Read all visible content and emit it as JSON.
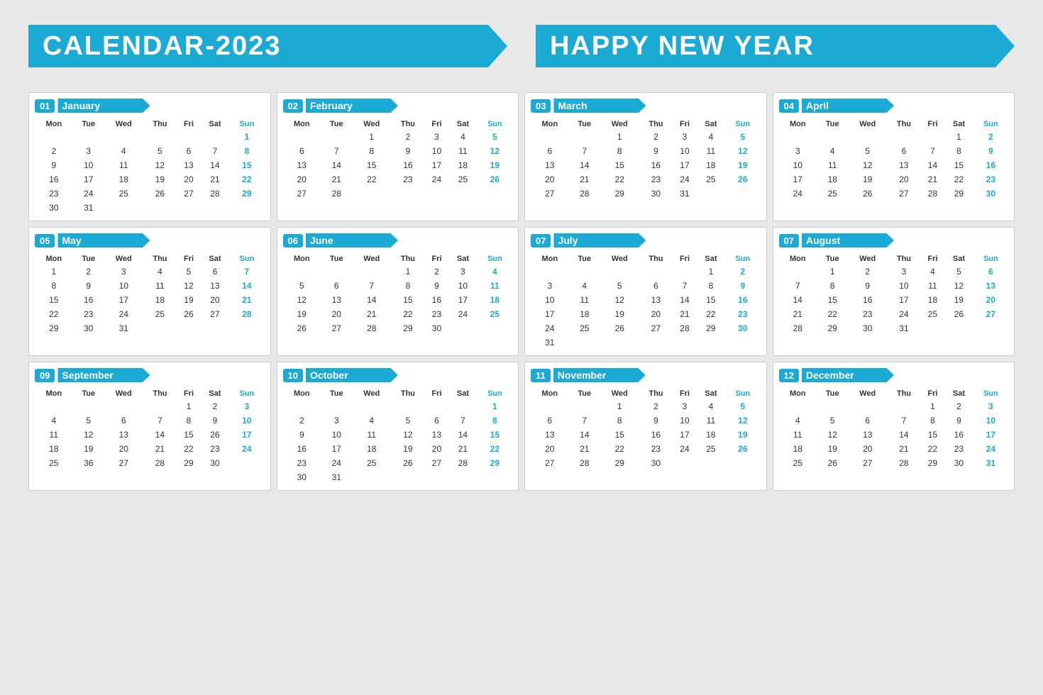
{
  "header": {
    "title": "CALENDAR-2023",
    "subtitle": "HAPPY NEW YEAR"
  },
  "months": [
    {
      "num": "01",
      "name": "January",
      "weeks": [
        [
          "",
          "",
          "",
          "",
          "",
          "",
          "1"
        ],
        [
          "2",
          "3",
          "4",
          "5",
          "6",
          "7",
          "8"
        ],
        [
          "9",
          "10",
          "11",
          "12",
          "13",
          "14",
          "15"
        ],
        [
          "16",
          "17",
          "18",
          "19",
          "20",
          "21",
          "22"
        ],
        [
          "23",
          "24",
          "25",
          "26",
          "27",
          "28",
          "29"
        ],
        [
          "30",
          "31",
          "",
          "",
          "",
          "",
          ""
        ]
      ]
    },
    {
      "num": "02",
      "name": "February",
      "weeks": [
        [
          "",
          "",
          "1",
          "2",
          "3",
          "4",
          "5"
        ],
        [
          "6",
          "7",
          "8",
          "9",
          "10",
          "11",
          "12"
        ],
        [
          "13",
          "14",
          "15",
          "16",
          "17",
          "18",
          "19"
        ],
        [
          "20",
          "21",
          "22",
          "23",
          "24",
          "25",
          "26"
        ],
        [
          "27",
          "28",
          "",
          "",
          "",
          "",
          ""
        ],
        [
          "",
          "",
          "",
          "",
          "",
          "",
          ""
        ]
      ]
    },
    {
      "num": "03",
      "name": "March",
      "weeks": [
        [
          "",
          "",
          "1",
          "2",
          "3",
          "4",
          "5"
        ],
        [
          "6",
          "7",
          "8",
          "9",
          "10",
          "11",
          "12"
        ],
        [
          "13",
          "14",
          "15",
          "16",
          "17",
          "18",
          "19"
        ],
        [
          "20",
          "21",
          "22",
          "23",
          "24",
          "25",
          "26"
        ],
        [
          "27",
          "28",
          "29",
          "30",
          "31",
          "",
          ""
        ],
        [
          "",
          "",
          "",
          "",
          "",
          "",
          ""
        ]
      ]
    },
    {
      "num": "04",
      "name": "April",
      "weeks": [
        [
          "",
          "",
          "",
          "",
          "",
          "1",
          "2"
        ],
        [
          "3",
          "4",
          "5",
          "6",
          "7",
          "8",
          "9"
        ],
        [
          "10",
          "11",
          "12",
          "13",
          "14",
          "15",
          "16"
        ],
        [
          "17",
          "18",
          "19",
          "20",
          "21",
          "22",
          "23"
        ],
        [
          "24",
          "25",
          "26",
          "27",
          "28",
          "29",
          "30"
        ],
        [
          "",
          "",
          "",
          "",
          "",
          "",
          ""
        ]
      ]
    },
    {
      "num": "05",
      "name": "May",
      "weeks": [
        [
          "1",
          "2",
          "3",
          "4",
          "5",
          "6",
          "7"
        ],
        [
          "8",
          "9",
          "10",
          "11",
          "12",
          "13",
          "14"
        ],
        [
          "15",
          "16",
          "17",
          "18",
          "19",
          "20",
          "21"
        ],
        [
          "22",
          "23",
          "24",
          "25",
          "26",
          "27",
          "28"
        ],
        [
          "29",
          "30",
          "31",
          "",
          "",
          "",
          ""
        ],
        [
          "",
          "",
          "",
          "",
          "",
          "",
          ""
        ]
      ]
    },
    {
      "num": "06",
      "name": "June",
      "weeks": [
        [
          "",
          "",
          "",
          "1",
          "2",
          "3",
          "4"
        ],
        [
          "5",
          "6",
          "7",
          "8",
          "9",
          "10",
          "11"
        ],
        [
          "12",
          "13",
          "14",
          "15",
          "16",
          "17",
          "18"
        ],
        [
          "19",
          "20",
          "21",
          "22",
          "23",
          "24",
          "25"
        ],
        [
          "26",
          "27",
          "28",
          "29",
          "30",
          "",
          ""
        ],
        [
          "",
          "",
          "",
          "",
          "",
          "",
          ""
        ]
      ]
    },
    {
      "num": "07",
      "name": "July",
      "weeks": [
        [
          "",
          "",
          "",
          "",
          "",
          "1",
          "2"
        ],
        [
          "3",
          "4",
          "5",
          "6",
          "7",
          "8",
          "9"
        ],
        [
          "10",
          "11",
          "12",
          "13",
          "14",
          "15",
          "16"
        ],
        [
          "17",
          "18",
          "19",
          "20",
          "21",
          "22",
          "23"
        ],
        [
          "24",
          "25",
          "26",
          "27",
          "28",
          "29",
          "30"
        ],
        [
          "31",
          "",
          "",
          "",
          "",
          "",
          ""
        ]
      ]
    },
    {
      "num": "07",
      "name": "August",
      "weeks": [
        [
          "",
          "1",
          "2",
          "3",
          "4",
          "5",
          "6"
        ],
        [
          "7",
          "8",
          "9",
          "10",
          "11",
          "12",
          "13"
        ],
        [
          "14",
          "15",
          "16",
          "17",
          "18",
          "19",
          "20"
        ],
        [
          "21",
          "22",
          "23",
          "24",
          "25",
          "26",
          "27"
        ],
        [
          "28",
          "29",
          "30",
          "31",
          "",
          "",
          ""
        ],
        [
          "",
          "",
          "",
          "",
          "",
          "",
          ""
        ]
      ]
    },
    {
      "num": "09",
      "name": "September",
      "weeks": [
        [
          "",
          "",
          "",
          "",
          "1",
          "2",
          "3"
        ],
        [
          "4",
          "5",
          "6",
          "7",
          "8",
          "9",
          "10"
        ],
        [
          "11",
          "12",
          "13",
          "14",
          "15",
          "26",
          "17"
        ],
        [
          "18",
          "19",
          "20",
          "21",
          "22",
          "23",
          "24"
        ],
        [
          "25",
          "36",
          "27",
          "28",
          "29",
          "30",
          ""
        ],
        [
          "",
          "",
          "",
          "",
          "",
          "",
          ""
        ]
      ]
    },
    {
      "num": "10",
      "name": "October",
      "weeks": [
        [
          "",
          "",
          "",
          "",
          "",
          "",
          "1"
        ],
        [
          "2",
          "3",
          "4",
          "5",
          "6",
          "7",
          "8"
        ],
        [
          "9",
          "10",
          "11",
          "12",
          "13",
          "14",
          "15"
        ],
        [
          "16",
          "17",
          "18",
          "19",
          "20",
          "21",
          "22"
        ],
        [
          "23",
          "24",
          "25",
          "26",
          "27",
          "28",
          "29"
        ],
        [
          "30",
          "31",
          "",
          "",
          "",
          "",
          ""
        ]
      ]
    },
    {
      "num": "11",
      "name": "November",
      "weeks": [
        [
          "",
          "",
          "1",
          "2",
          "3",
          "4",
          "5"
        ],
        [
          "6",
          "7",
          "8",
          "9",
          "10",
          "11",
          "12"
        ],
        [
          "13",
          "14",
          "15",
          "16",
          "17",
          "18",
          "19"
        ],
        [
          "20",
          "21",
          "22",
          "23",
          "24",
          "25",
          "26"
        ],
        [
          "27",
          "28",
          "29",
          "30",
          "",
          "",
          ""
        ],
        [
          "",
          "",
          "",
          "",
          "",
          "",
          ""
        ]
      ]
    },
    {
      "num": "12",
      "name": "December",
      "weeks": [
        [
          "",
          "",
          "",
          "",
          "1",
          "2",
          "3"
        ],
        [
          "4",
          "5",
          "6",
          "7",
          "8",
          "9",
          "10"
        ],
        [
          "11",
          "12",
          "13",
          "14",
          "15",
          "16",
          "17"
        ],
        [
          "18",
          "19",
          "20",
          "21",
          "22",
          "23",
          "24"
        ],
        [
          "25",
          "26",
          "27",
          "28",
          "29",
          "30",
          "31"
        ],
        [
          "",
          "",
          "",
          "",
          "",
          "",
          ""
        ]
      ]
    }
  ]
}
